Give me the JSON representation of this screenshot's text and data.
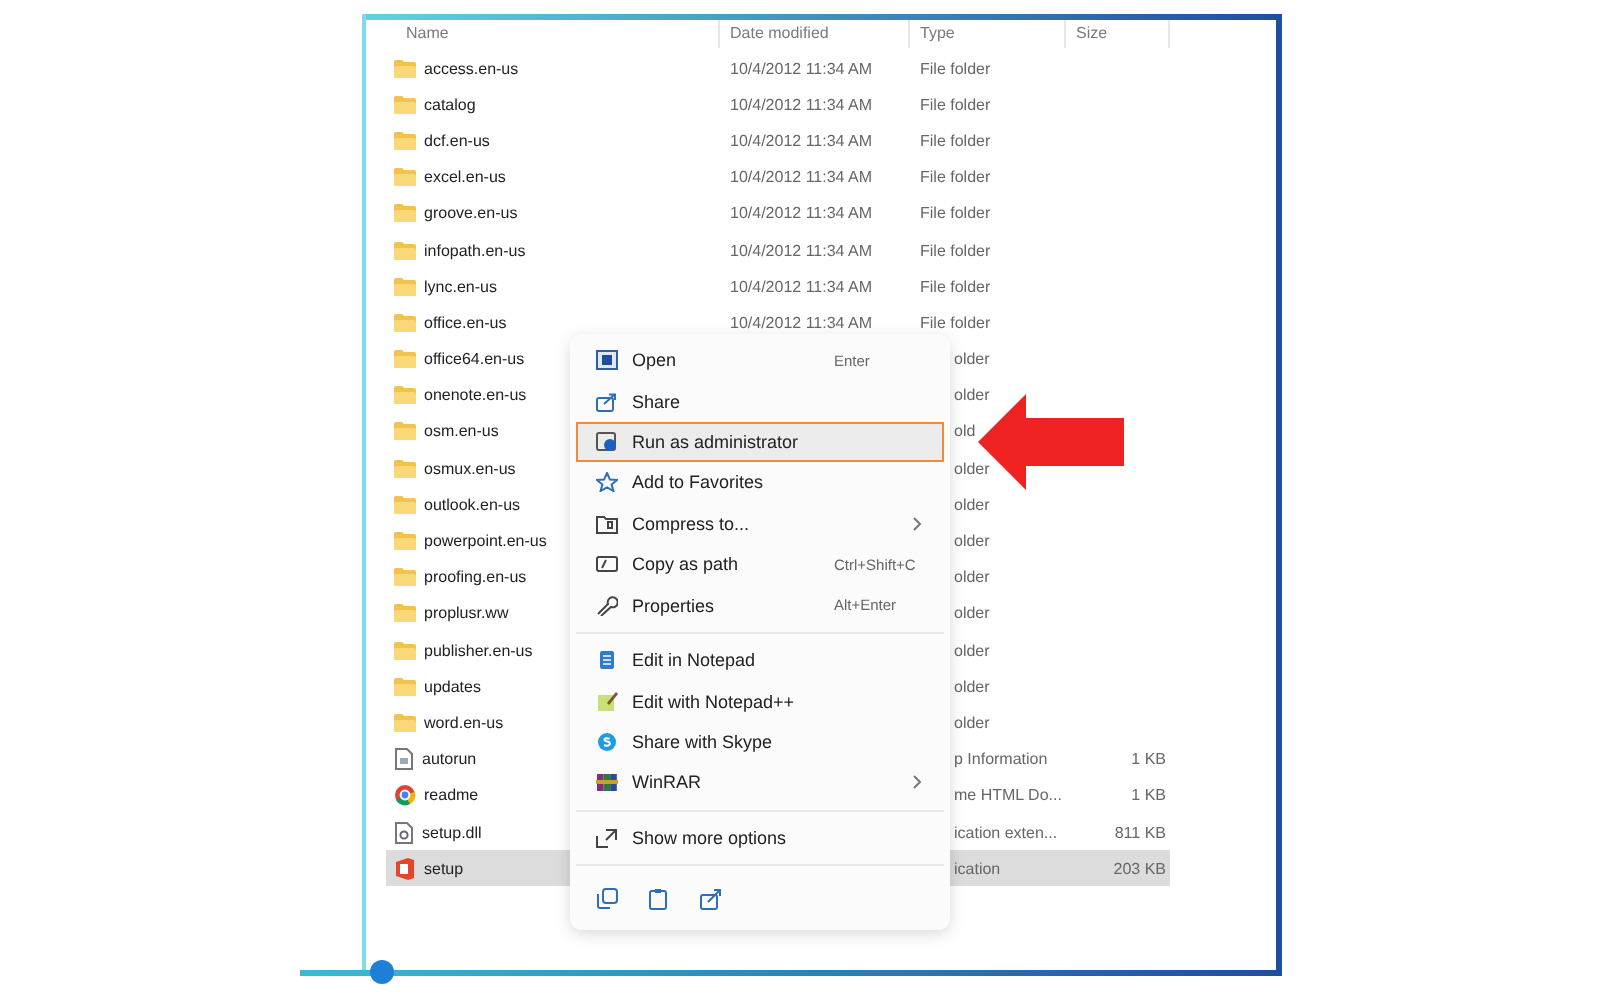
{
  "columns": [
    "Name",
    "Date modified",
    "Type",
    "Size"
  ],
  "rows": [
    {
      "kind": "folder",
      "name": "access.en-us",
      "date": "10/4/2012 11:34 AM",
      "type": "File folder",
      "selected": false
    },
    {
      "kind": "folder",
      "name": "catalog",
      "date": "10/4/2012 11:34 AM",
      "type": "File folder",
      "selected": false
    },
    {
      "kind": "folder",
      "name": "dcf.en-us",
      "date": "10/4/2012 11:34 AM",
      "type": "File folder",
      "selected": false
    },
    {
      "kind": "folder",
      "name": "excel.en-us",
      "date": "10/4/2012 11:34 AM",
      "type": "File folder",
      "selected": false
    },
    {
      "kind": "folder",
      "name": "groove.en-us",
      "date": "10/4/2012 11:34 AM",
      "type": "File folder",
      "selected": false
    },
    {
      "kind": "folder",
      "name": "infopath.en-us",
      "date": "10/4/2012 11:34 AM",
      "type": "File folder",
      "selected": false
    },
    {
      "kind": "folder",
      "name": "lync.en-us",
      "date": "10/4/2012 11:34 AM",
      "type": "File folder",
      "selected": false
    },
    {
      "kind": "folder",
      "name": "office.en-us",
      "date": "10/4/2012 11:34 AM",
      "type": "File folder",
      "selected": false
    },
    {
      "kind": "folder",
      "name": "office64.en-us",
      "type": "older",
      "selected": false
    },
    {
      "kind": "folder",
      "name": "onenote.en-us",
      "type": "older",
      "selected": false
    },
    {
      "kind": "folder",
      "name": "osm.en-us",
      "type": "old",
      "selected": false
    },
    {
      "kind": "folder",
      "name": "osmux.en-us",
      "type": "older",
      "selected": false
    },
    {
      "kind": "folder",
      "name": "outlook.en-us",
      "type": "older",
      "selected": false
    },
    {
      "kind": "folder",
      "name": "powerpoint.en-us",
      "type": "older",
      "selected": false
    },
    {
      "kind": "folder",
      "name": "proofing.en-us",
      "type": "older",
      "selected": false
    },
    {
      "kind": "folder",
      "name": "proplusr.ww",
      "type": "older",
      "selected": false
    },
    {
      "kind": "folder",
      "name": "publisher.en-us",
      "type": "older",
      "selected": false
    },
    {
      "kind": "folder",
      "name": "updates",
      "type": "older",
      "selected": false
    },
    {
      "kind": "folder",
      "name": "word.en-us",
      "type": "older",
      "selected": false
    },
    {
      "kind": "file",
      "name": "autorun",
      "type": "p Information",
      "size": "1 KB",
      "selected": false
    },
    {
      "kind": "browser",
      "name": "readme",
      "type": "me HTML Do...",
      "size": "1 KB",
      "selected": false
    },
    {
      "kind": "dll",
      "name": "setup.dll",
      "type": "ication exten...",
      "size": "811 KB",
      "selected": false
    },
    {
      "kind": "app",
      "name": "setup",
      "type": "ication",
      "size": "203 KB",
      "selected": true
    }
  ],
  "context_menu": {
    "sections": [
      [
        {
          "label": "Open",
          "shortcut": "Enter",
          "submenu": false,
          "selected": false
        },
        {
          "label": "Share",
          "submenu": false,
          "selected": false
        },
        {
          "label": "Run as administrator",
          "submenu": false,
          "selected": true
        },
        {
          "label": "Add to Favorites",
          "submenu": false,
          "selected": false
        },
        {
          "label": "Compress to...",
          "submenu": true,
          "selected": false
        },
        {
          "label": "Copy as path",
          "shortcut": "Ctrl+Shift+C",
          "submenu": false,
          "selected": false
        },
        {
          "label": "Properties",
          "shortcut": "Alt+Enter",
          "submenu": false,
          "selected": false
        }
      ],
      [
        {
          "label": "Edit in Notepad",
          "submenu": false,
          "selected": false
        },
        {
          "label": "Edit with Notepad++",
          "submenu": false,
          "selected": false
        },
        {
          "label": "Share with Skype",
          "submenu": false,
          "selected": false
        },
        {
          "label": "WinRAR",
          "submenu": true,
          "selected": false
        }
      ],
      [
        {
          "label": "Show more options",
          "submenu": false,
          "selected": false
        }
      ]
    ]
  }
}
